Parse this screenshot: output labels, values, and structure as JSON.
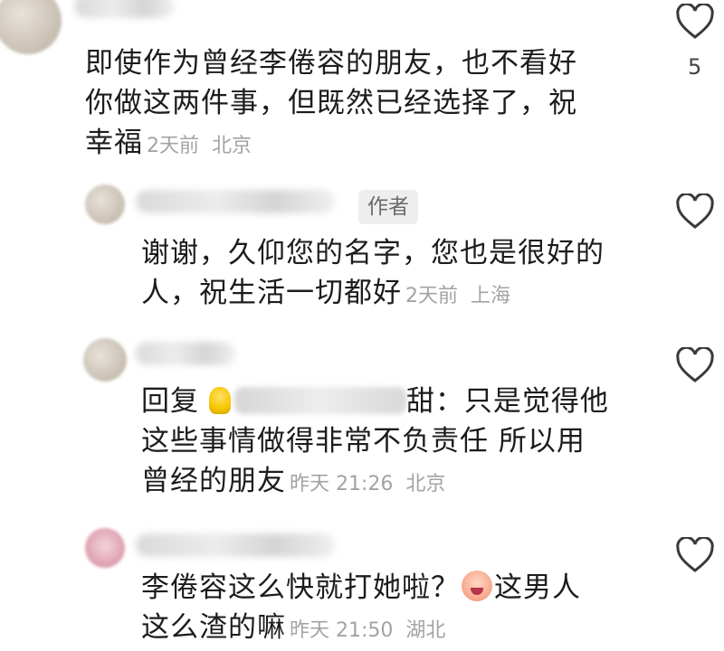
{
  "comments": [
    {
      "text_lines": [
        "即使作为曾经李倦容的朋友，也不看好",
        "你做这两件事，但既然已经选择了，祝",
        "幸福"
      ],
      "time": "2天前",
      "location": "北京",
      "likes": "5",
      "icons": {
        "avatar": "user-avatar",
        "like": "heart-outline-icon"
      }
    },
    {
      "author_tag": "作者",
      "text_lines": [
        "谢谢，久仰您的名字，您也是很好的",
        "人，祝生活一切都好"
      ],
      "time": "2天前",
      "location": "上海",
      "icons": {
        "avatar": "user-avatar",
        "like": "heart-outline-icon"
      }
    },
    {
      "reply_prefix": "回复",
      "reply_suffix": "甜：只是觉得他",
      "text_lines": [
        "这些事情做得非常不负责任 所以用",
        "曾经的朋友"
      ],
      "time": "昨天 21:26",
      "location": "北京",
      "icons": {
        "avatar": "user-avatar",
        "reply_badge": "lightbulb-icon",
        "like": "heart-outline-icon"
      }
    },
    {
      "text_lines": [
        "李倦容这么快就打她啦？",
        "这男人",
        "这么渣的嘛"
      ],
      "time": "昨天 21:50",
      "location": "湖北",
      "icons": {
        "avatar": "user-avatar",
        "emoji": "crying-face-emoji",
        "like": "heart-outline-icon"
      }
    }
  ],
  "colors": {
    "text": "#1c1c1c",
    "meta": "#a3a3a3",
    "tag_bg": "#eeeeee",
    "icon": "#3a3a3a"
  }
}
